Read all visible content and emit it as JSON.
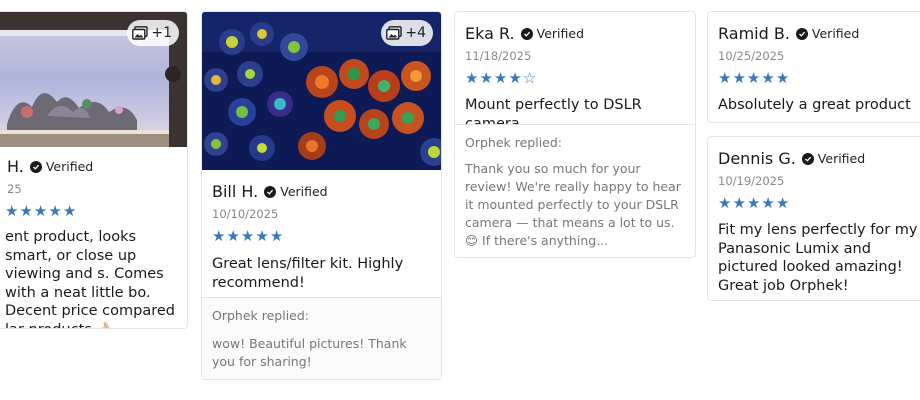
{
  "colors": {
    "star": "#3b78b9",
    "border": "#e5e5e5",
    "muted": "#777777"
  },
  "reviews": [
    {
      "id": "r1",
      "author": "H.",
      "verified": "Verified",
      "date": "25",
      "rating": 5,
      "photo_count": "+1",
      "text": "ent product, looks smart, or close up viewing and s. Comes with a neat little bo. Decent price compared lar products 👌🏻"
    },
    {
      "id": "r2",
      "author": "Bill H.",
      "verified": "Verified",
      "date": "10/10/2025",
      "rating": 5,
      "photo_count": "+4",
      "text": "Great lens/filter kit. Highly recommend!",
      "reply_author": "Orphek replied:",
      "reply": "wow! Beautiful pictures! Thank you for sharing!"
    },
    {
      "id": "r3",
      "author": "Eka R.",
      "verified": "Verified",
      "date": "11/18/2025",
      "rating": 4,
      "text": "Mount perfectly to DSLR camera",
      "reply_author": "Orphek replied:",
      "reply": "Thank you so much for your review! We're really happy to hear it mounted perfectly to your DSLR camera — that means a lot to us. 😊 If there's anything..."
    },
    {
      "id": "r4",
      "author": "Ramid B.",
      "verified": "Verified",
      "date": "10/25/2025",
      "rating": 5,
      "text": "Absolutely a great product"
    },
    {
      "id": "r5",
      "author": "Dennis G.",
      "verified": "Verified",
      "date": "10/19/2025",
      "rating": 5,
      "text": "Fit my lens perfectly for my Panasonic Lumix and pictured looked amazing! Great job Orphek!"
    }
  ]
}
